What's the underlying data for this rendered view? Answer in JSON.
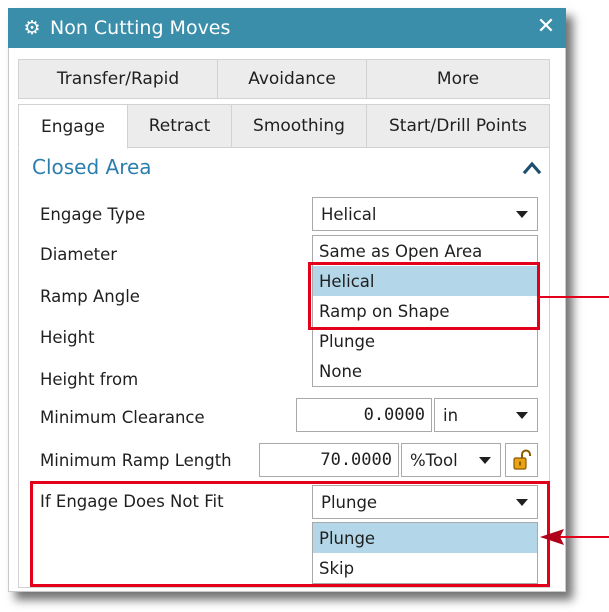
{
  "dialog": {
    "title": "Non Cutting Moves",
    "close_symbol": "✕",
    "gear_symbol": "⚙"
  },
  "tabs_row1": [
    {
      "label": "Transfer/Rapid"
    },
    {
      "label": "Avoidance"
    },
    {
      "label": "More"
    }
  ],
  "tabs_row2": [
    {
      "label": "Engage",
      "active": true
    },
    {
      "label": "Retract"
    },
    {
      "label": "Smoothing"
    },
    {
      "label": "Start/Drill Points"
    }
  ],
  "section": {
    "title": "Closed Area",
    "collapse_icon": "chevron-up-icon"
  },
  "fields": {
    "engage_type": {
      "label": "Engage Type",
      "value": "Helical"
    },
    "diameter": {
      "label": "Diameter"
    },
    "ramp_angle": {
      "label": "Ramp Angle"
    },
    "height": {
      "label": "Height"
    },
    "height_from": {
      "label": "Height from"
    },
    "minimum_clearance": {
      "label": "Minimum Clearance",
      "value": "0.0000",
      "unit": "in"
    },
    "minimum_ramp_length": {
      "label": "Minimum Ramp Length",
      "value": "70.0000",
      "unit": "%Tool"
    },
    "if_engage_does_not_fit": {
      "label": "If Engage Does Not Fit",
      "value": "Plunge"
    }
  },
  "engage_type_options": [
    {
      "label": "Same as Open Area"
    },
    {
      "label": "Helical",
      "selected": true
    },
    {
      "label": "Ramp on Shape"
    },
    {
      "label": "Plunge"
    },
    {
      "label": "None"
    }
  ],
  "fit_options": [
    {
      "label": "Plunge",
      "selected": true
    },
    {
      "label": "Skip"
    }
  ],
  "colors": {
    "titlebar": "#3a8eaa",
    "section_title": "#2b7fae",
    "selection": "#b3d7e8",
    "annotation_red": "#e3001b",
    "lock_icon": "#e8a317"
  }
}
